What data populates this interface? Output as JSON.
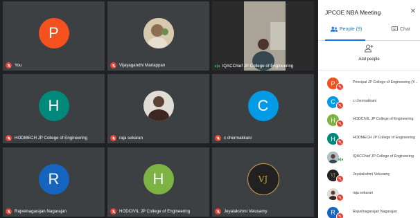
{
  "meeting": {
    "title": "JPCOE NBA Meeting"
  },
  "tabs": {
    "people_label": "People (9)",
    "chat_label": "Chat"
  },
  "add_people_label": "Add people",
  "colors": {
    "orange": "#f4511e",
    "teal": "#00897b",
    "blue": "#039be5",
    "navy": "#1565c0",
    "green": "#7cb342",
    "dark": "#303030"
  },
  "tiles": [
    {
      "name": "You",
      "initial": "P",
      "color": "#f4511e",
      "kind": "letter",
      "mic": "off"
    },
    {
      "name": "Vijayagandhi Mariappan",
      "kind": "photo",
      "mic": "off"
    },
    {
      "name": "IQACChief JP College of Engineering",
      "kind": "video",
      "mic": "speaking"
    },
    {
      "name": "HODMECH JP College of Engineering",
      "initial": "H",
      "color": "#00897b",
      "kind": "letter",
      "mic": "off"
    },
    {
      "name": "raja sekaran",
      "kind": "photo",
      "mic": "off"
    },
    {
      "name": "c chermakkani",
      "initial": "C",
      "color": "#039be5",
      "kind": "letter",
      "mic": "off"
    },
    {
      "name": "Rajvelnagarajan Nagarajan",
      "initial": "R",
      "color": "#1565c0",
      "kind": "letter",
      "mic": "off"
    },
    {
      "name": "HODCIVIL JP College of Engineering",
      "initial": "H",
      "color": "#7cb342",
      "kind": "letter",
      "mic": "off"
    },
    {
      "name": "Jeyalakshmi Velusamy",
      "initial": "VJ",
      "color": "#212121",
      "kind": "logo",
      "mic": "off"
    }
  ],
  "participants": [
    {
      "name": "Principal JP College of Engineering (Y...",
      "initial": "P",
      "color": "#f4511e"
    },
    {
      "name": "c chermakkani",
      "initial": "C",
      "color": "#039be5"
    },
    {
      "name": "HODCIVIL JP College of Engineering",
      "initial": "H",
      "color": "#7cb342"
    },
    {
      "name": "HODMECH JP College of Engineering",
      "initial": "H",
      "color": "#00897b"
    },
    {
      "name": "IQACChief JP College of Engineering",
      "initial": "",
      "color": "#90a4ae"
    },
    {
      "name": "Jeyalakshmi Velusamy",
      "initial": "VJ",
      "color": "#212121"
    },
    {
      "name": "raja sekaran",
      "initial": "",
      "color": "#8d6e63"
    },
    {
      "name": "Rajvelnagarajan Nagarajan",
      "initial": "R",
      "color": "#1565c0"
    }
  ]
}
